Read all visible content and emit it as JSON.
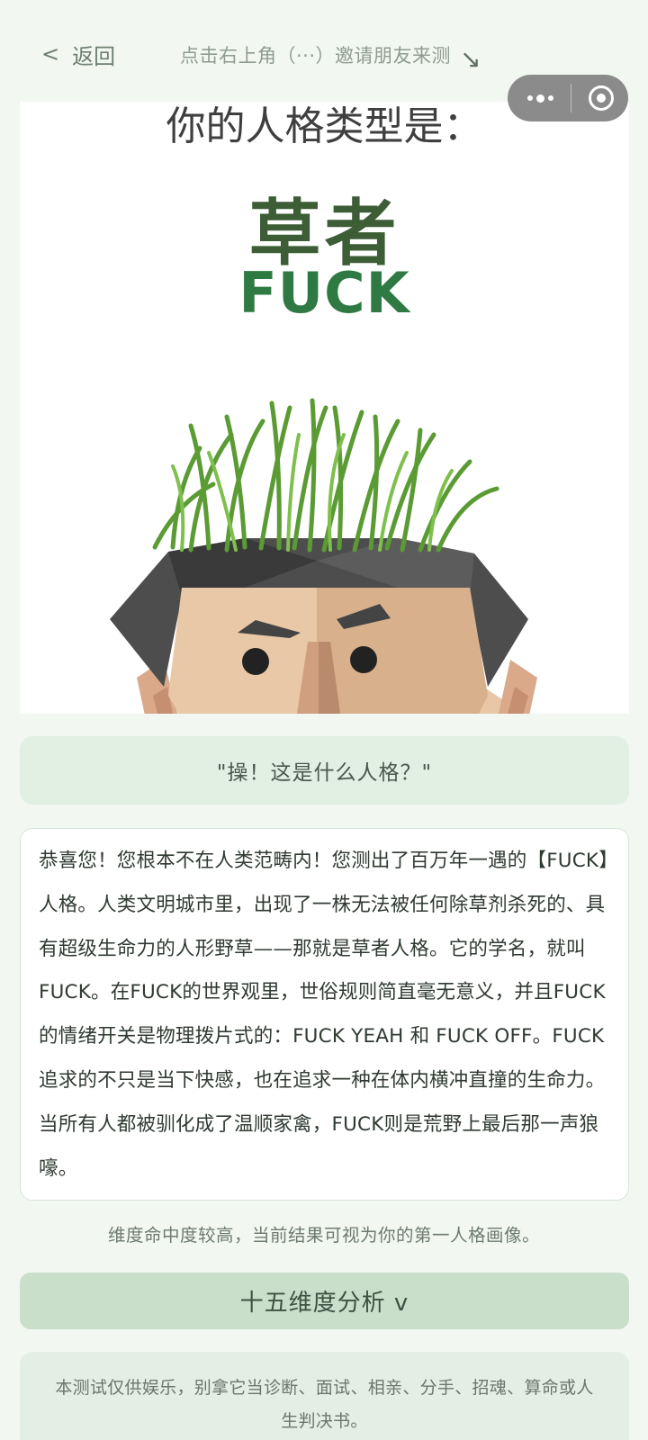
{
  "nav": {
    "back_chevron": "<",
    "back_label": "返回",
    "hint_text": "点击右上角（···）邀请朋友来测",
    "hint_arrow": "↘"
  },
  "capsule": {
    "more_icon": "more-dots-icon",
    "close_icon": "target-circle-icon"
  },
  "result": {
    "intro": "你的人格类型是：",
    "type_cn": "草者",
    "type_en": "FUCK"
  },
  "quote": "\"操！这是什么人格？\"",
  "description": "恭喜您！您根本不在人类范畴内！您测出了百万年一遇的【FUCK】人格。人类文明城市里，出现了一株无法被任何除草剂杀死的、具有超级生命力的人形野草——那就是草者人格。它的学名，就叫 FUCK。在FUCK的世界观里，世俗规则简直毫无意义，并且FUCK的情绪开关是物理拨片式的：FUCK YEAH 和 FUCK OFF。FUCK追求的不只是当下快感，也在追求一种在体内横冲直撞的生命力。当所有人都被驯化成了温顺家禽，FUCK则是荒野上最后那一声狼嚎。",
  "note": "维度命中度较高，当前结果可视为你的第一人格画像。",
  "analysis_button": "十五维度分析 v",
  "disclaimer": "本测试仅供娱乐，别拿它当诊断、面试、相亲、分手、招魂、算命或人生判决书。",
  "colors": {
    "background": "#f2f7f2",
    "quote_bg": "#e2efe3",
    "button_bg": "#c9dfca",
    "accent_green": "#2f7a43"
  }
}
